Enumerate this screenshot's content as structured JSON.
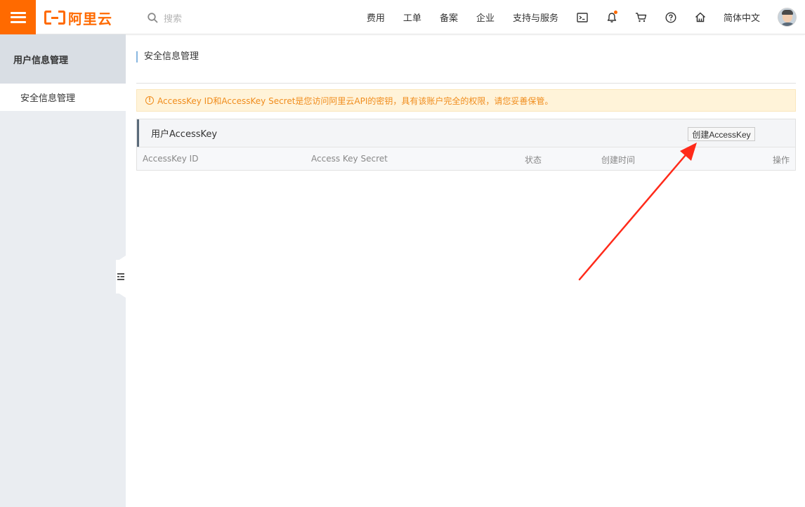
{
  "header": {
    "logo_text": "阿里云",
    "search_placeholder": "搜索",
    "nav": [
      "费用",
      "工单",
      "备案",
      "企业",
      "支持与服务"
    ],
    "icons": [
      "terminal-icon",
      "bell-icon",
      "cart-icon",
      "help-icon",
      "home-icon"
    ],
    "language": "简体中文",
    "accent_color": "#ff6a00"
  },
  "sidebar": {
    "title": "用户信息管理",
    "items": [
      {
        "label": "安全信息管理"
      }
    ]
  },
  "main": {
    "page_title": "安全信息管理",
    "warning": "AccessKey ID和AccessKey Secret是您访问阿里云API的密钥，具有该账户完全的权限，请您妥善保管。",
    "panel_title": "用户AccessKey",
    "create_button": "创建AccessKey",
    "columns": [
      "AccessKey ID",
      "Access Key Secret",
      "状态",
      "创建时间",
      "操作"
    ],
    "rows": []
  },
  "annotation": {
    "arrow_color": "#ff2a1a"
  }
}
